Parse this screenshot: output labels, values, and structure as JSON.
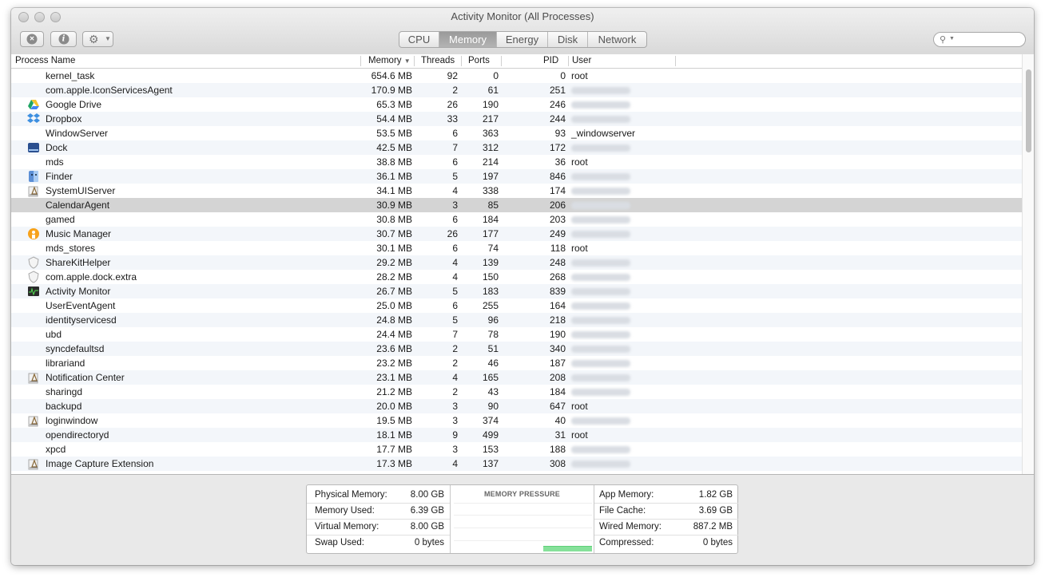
{
  "window": {
    "title": "Activity Monitor (All Processes)"
  },
  "toolbar": {
    "quit_icon": "x-circle-icon",
    "info_icon": "info-icon",
    "gear_icon": "gear-icon",
    "tabs": [
      "CPU",
      "Memory",
      "Energy",
      "Disk",
      "Network"
    ],
    "active_tab": "Memory",
    "search": {
      "value": ""
    }
  },
  "table": {
    "columns": {
      "name": "Process Name",
      "memory": "Memory",
      "threads": "Threads",
      "ports": "Ports",
      "pid": "PID",
      "user": "User"
    },
    "sort": {
      "column": "Memory",
      "direction": "descending"
    },
    "selected_row": "CalendarAgent",
    "rows": [
      {
        "name": "kernel_task",
        "memory": "654.6 MB",
        "threads": "92",
        "ports": "0",
        "pid": "0",
        "user": "root",
        "icon": ""
      },
      {
        "name": "com.apple.IconServicesAgent",
        "memory": "170.9 MB",
        "threads": "2",
        "ports": "61",
        "pid": "251",
        "user": "",
        "icon": ""
      },
      {
        "name": "Google Drive",
        "memory": "65.3 MB",
        "threads": "26",
        "ports": "190",
        "pid": "246",
        "user": "",
        "icon": "google-drive-icon"
      },
      {
        "name": "Dropbox",
        "memory": "54.4 MB",
        "threads": "33",
        "ports": "217",
        "pid": "244",
        "user": "",
        "icon": "dropbox-icon"
      },
      {
        "name": "WindowServer",
        "memory": "53.5 MB",
        "threads": "6",
        "ports": "363",
        "pid": "93",
        "user": "_windowserver",
        "icon": ""
      },
      {
        "name": "Dock",
        "memory": "42.5 MB",
        "threads": "7",
        "ports": "312",
        "pid": "172",
        "user": "",
        "icon": "dock-icon"
      },
      {
        "name": "mds",
        "memory": "38.8 MB",
        "threads": "6",
        "ports": "214",
        "pid": "36",
        "user": "root",
        "icon": ""
      },
      {
        "name": "Finder",
        "memory": "36.1 MB",
        "threads": "5",
        "ports": "197",
        "pid": "846",
        "user": "",
        "icon": "finder-icon"
      },
      {
        "name": "SystemUIServer",
        "memory": "34.1 MB",
        "threads": "4",
        "ports": "338",
        "pid": "174",
        "user": "",
        "icon": "app-icon"
      },
      {
        "name": "CalendarAgent",
        "memory": "30.9 MB",
        "threads": "3",
        "ports": "85",
        "pid": "206",
        "user": "",
        "icon": ""
      },
      {
        "name": "gamed",
        "memory": "30.8 MB",
        "threads": "6",
        "ports": "184",
        "pid": "203",
        "user": "",
        "icon": ""
      },
      {
        "name": "Music Manager",
        "memory": "30.7 MB",
        "threads": "26",
        "ports": "177",
        "pid": "249",
        "user": "",
        "icon": "music-manager-icon"
      },
      {
        "name": "mds_stores",
        "memory": "30.1 MB",
        "threads": "6",
        "ports": "74",
        "pid": "118",
        "user": "root",
        "icon": ""
      },
      {
        "name": "ShareKitHelper",
        "memory": "29.2 MB",
        "threads": "4",
        "ports": "139",
        "pid": "248",
        "user": "",
        "icon": "shield-icon"
      },
      {
        "name": "com.apple.dock.extra",
        "memory": "28.2 MB",
        "threads": "4",
        "ports": "150",
        "pid": "268",
        "user": "",
        "icon": "shield-icon"
      },
      {
        "name": "Activity Monitor",
        "memory": "26.7 MB",
        "threads": "5",
        "ports": "183",
        "pid": "839",
        "user": "",
        "icon": "activity-monitor-icon"
      },
      {
        "name": "UserEventAgent",
        "memory": "25.0 MB",
        "threads": "6",
        "ports": "255",
        "pid": "164",
        "user": "",
        "icon": ""
      },
      {
        "name": "identityservicesd",
        "memory": "24.8 MB",
        "threads": "5",
        "ports": "96",
        "pid": "218",
        "user": "",
        "icon": ""
      },
      {
        "name": "ubd",
        "memory": "24.4 MB",
        "threads": "7",
        "ports": "78",
        "pid": "190",
        "user": "",
        "icon": ""
      },
      {
        "name": "syncdefaultsd",
        "memory": "23.6 MB",
        "threads": "2",
        "ports": "51",
        "pid": "340",
        "user": "",
        "icon": ""
      },
      {
        "name": "librariand",
        "memory": "23.2 MB",
        "threads": "2",
        "ports": "46",
        "pid": "187",
        "user": "",
        "icon": ""
      },
      {
        "name": "Notification Center",
        "memory": "23.1 MB",
        "threads": "4",
        "ports": "165",
        "pid": "208",
        "user": "",
        "icon": "app-icon"
      },
      {
        "name": "sharingd",
        "memory": "21.2 MB",
        "threads": "2",
        "ports": "43",
        "pid": "184",
        "user": "",
        "icon": ""
      },
      {
        "name": "backupd",
        "memory": "20.0 MB",
        "threads": "3",
        "ports": "90",
        "pid": "647",
        "user": "root",
        "icon": ""
      },
      {
        "name": "loginwindow",
        "memory": "19.5 MB",
        "threads": "3",
        "ports": "374",
        "pid": "40",
        "user": "",
        "icon": "app-icon"
      },
      {
        "name": "opendirectoryd",
        "memory": "18.1 MB",
        "threads": "9",
        "ports": "499",
        "pid": "31",
        "user": "root",
        "icon": ""
      },
      {
        "name": "xpcd",
        "memory": "17.7 MB",
        "threads": "3",
        "ports": "153",
        "pid": "188",
        "user": "",
        "icon": ""
      },
      {
        "name": "Image Capture Extension",
        "memory": "17.3 MB",
        "threads": "4",
        "ports": "137",
        "pid": "308",
        "user": "",
        "icon": "app-icon"
      }
    ]
  },
  "memory_stats": {
    "physical_memory": {
      "label": "Physical Memory:",
      "value": "8.00 GB"
    },
    "memory_used": {
      "label": "Memory Used:",
      "value": "6.39 GB"
    },
    "virtual_memory": {
      "label": "Virtual Memory:",
      "value": "8.00 GB"
    },
    "swap_used": {
      "label": "Swap Used:",
      "value": "0 bytes"
    },
    "pressure_title": "MEMORY PRESSURE",
    "pressure_color": "#86e19a",
    "app_memory": {
      "label": "App Memory:",
      "value": "1.82 GB"
    },
    "file_cache": {
      "label": "File Cache:",
      "value": "3.69 GB"
    },
    "wired_memory": {
      "label": "Wired Memory:",
      "value": "887.2 MB"
    },
    "compressed": {
      "label": "Compressed:",
      "value": "0 bytes"
    }
  }
}
